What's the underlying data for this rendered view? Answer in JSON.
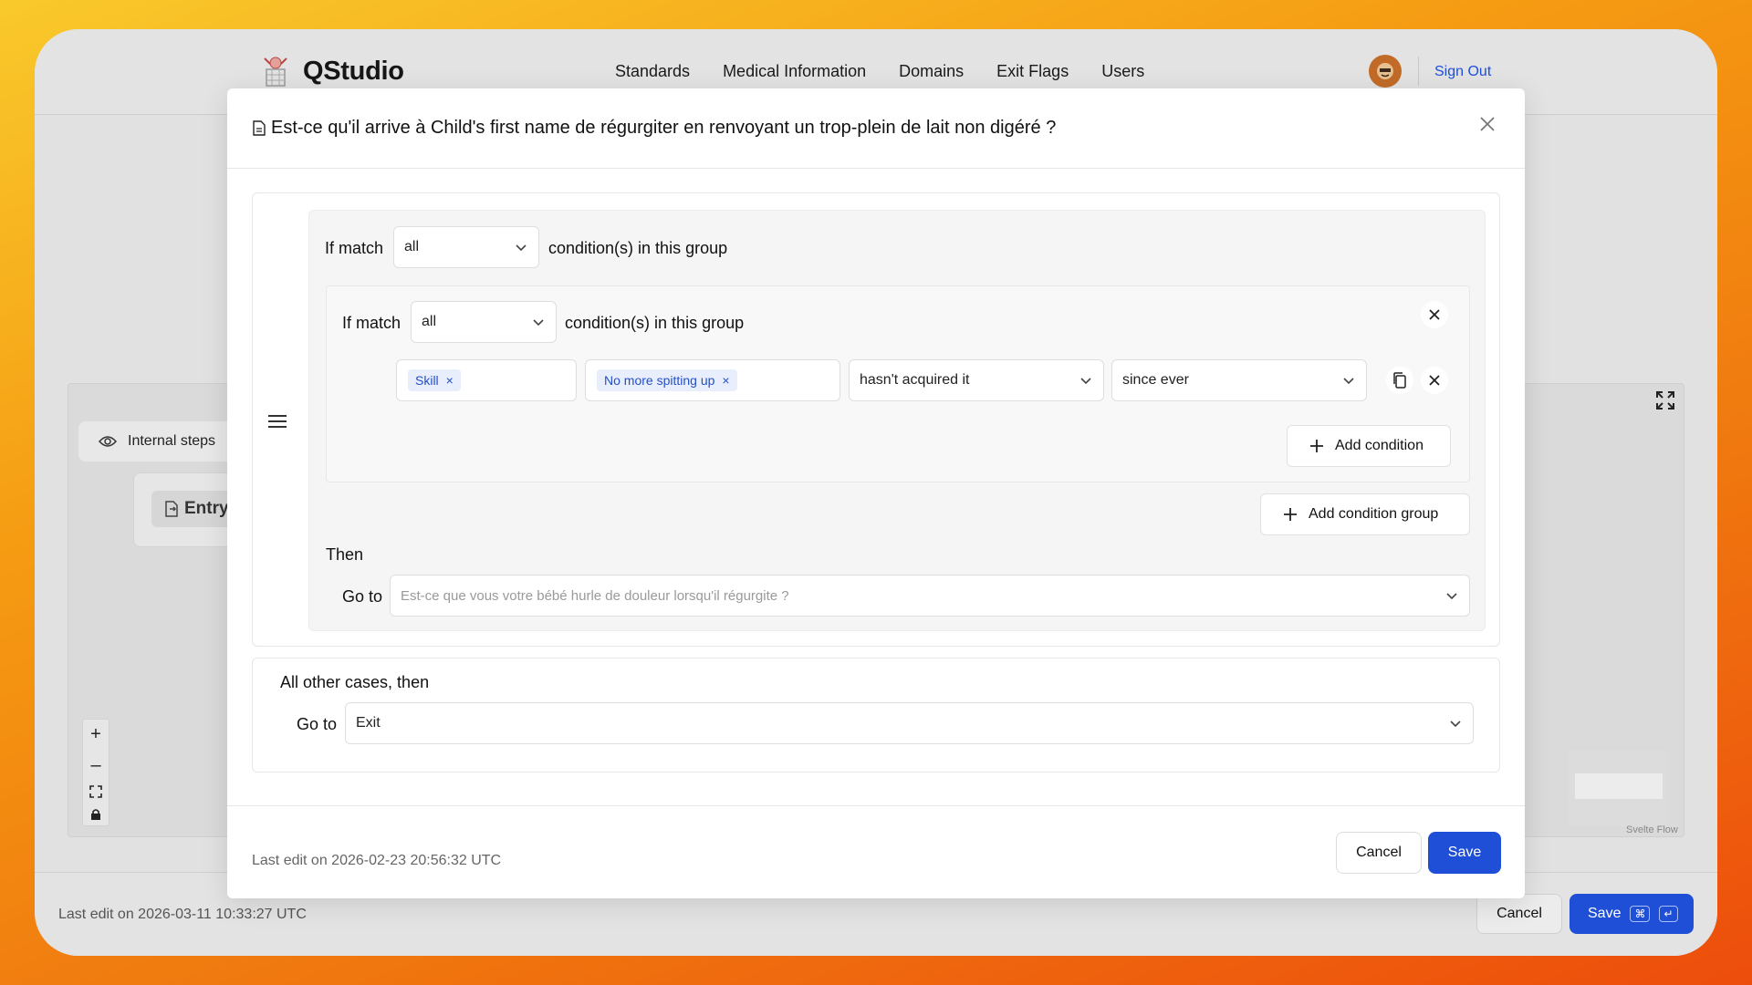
{
  "app": {
    "name": "QStudio",
    "nav": [
      "Standards",
      "Medical Information",
      "Domains",
      "Exit Flags",
      "Users"
    ],
    "sign_out": "Sign Out"
  },
  "canvas": {
    "internal_steps": "Internal steps",
    "entry_label": "Entry",
    "zoom_in": "+",
    "zoom_out": "–",
    "attribution": "Svelte Flow"
  },
  "page_footer": {
    "last_edit": "Last edit on 2026-03-11 10:33:27 UTC",
    "cancel": "Cancel",
    "save": "Save",
    "shortcut_cmd": "⌘",
    "shortcut_enter": "↵"
  },
  "modal": {
    "title": "Est-ce qu'il arrive à Child's first name de régurgiter en renvoyant un trop-plein de lait non digéré ?",
    "outer_group": {
      "if_match": "If match",
      "match_value": "all",
      "suffix": "condition(s) in this group"
    },
    "inner_group": {
      "if_match": "If match",
      "match_value": "all",
      "suffix": "condition(s) in this group",
      "condition": {
        "type_tag": "Skill",
        "value_tag": "No more spitting up",
        "operator": "hasn't acquired it",
        "timeframe": "since ever"
      },
      "add_condition": "Add condition"
    },
    "add_condition_group": "Add condition group",
    "then_label": "Then",
    "goto_label": "Go to",
    "goto_placeholder": "Est-ce que vous votre bébé hurle de douleur lorsqu'il régurgite ?",
    "other_cases": {
      "label": "All other cases, then",
      "goto_label": "Go to",
      "goto_value": "Exit"
    },
    "footer": {
      "last_edit": "Last edit on 2026-02-23 20:56:32 UTC",
      "cancel": "Cancel",
      "save": "Save"
    }
  },
  "colors": {
    "accent": "#1f4fd6",
    "tag_bg": "#e8eefc",
    "tag_text": "#2450c8"
  },
  "icons": [
    "logo-icon",
    "eye-icon",
    "file-icon",
    "expand-icon",
    "fit-view-icon",
    "lock-icon",
    "close-icon",
    "menu-icon",
    "chevron-down-icon",
    "copy-icon",
    "plus-icon"
  ]
}
